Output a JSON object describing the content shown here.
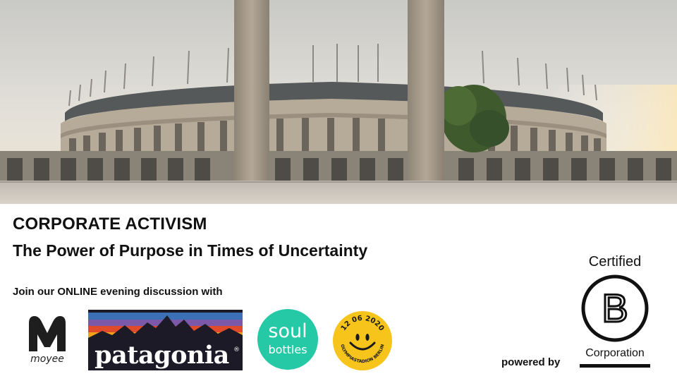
{
  "banner": {
    "title": "CORPORATE ACTIVISM",
    "subtitle": "The Power of Purpose in Times of Uncertainty",
    "invite": "Join our ONLINE evening discussion with",
    "powered_by": "powered by"
  },
  "partners": {
    "moyee": {
      "name": "moyee"
    },
    "patagonia": {
      "name": "patagonia",
      "mark": "®"
    },
    "soulbottles": {
      "line1": "soul",
      "line2": "bottles"
    },
    "stadium": {
      "top": "12 06 2020",
      "bottom": "OLYMPIASTADION BERLIN"
    }
  },
  "certification": {
    "certified": "Certified",
    "letter": "B",
    "corporation": "Corporation"
  },
  "colors": {
    "soulbottles_green": "#26c9a6",
    "smiley_yellow": "#f6c41a",
    "patagonia_dark": "#1c1a26"
  }
}
